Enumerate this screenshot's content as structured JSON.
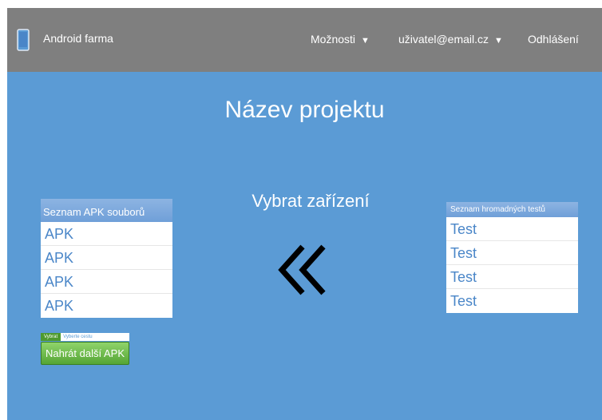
{
  "header": {
    "app_title": "Android farma",
    "logo_icon": "tablet-icon",
    "menu_options": "Možnosti",
    "user_email": "uživatel@email.cz",
    "logout": "Odhlášení",
    "caret": "▼"
  },
  "main": {
    "project_title": "Název projektu",
    "select_device": "Vybrat zařízení",
    "assign_icon": "double-chevron-left-icon"
  },
  "apk_list": {
    "header": "Seznam APK souborů",
    "items": [
      "APK",
      "APK",
      "APK",
      "APK"
    ]
  },
  "test_list": {
    "header": "Seznam hromadných testů",
    "items": [
      "Test",
      "Test",
      "Test",
      "Test"
    ]
  },
  "upload": {
    "choose_label": "Vybrat",
    "path_placeholder": "Vyberte cestu",
    "upload_button": "Nahrát další APK"
  },
  "colors": {
    "background": "#5b9bd5",
    "topbar": "#7f7f7f",
    "list_text": "#4a86c8",
    "upload_button": "#55a536"
  }
}
